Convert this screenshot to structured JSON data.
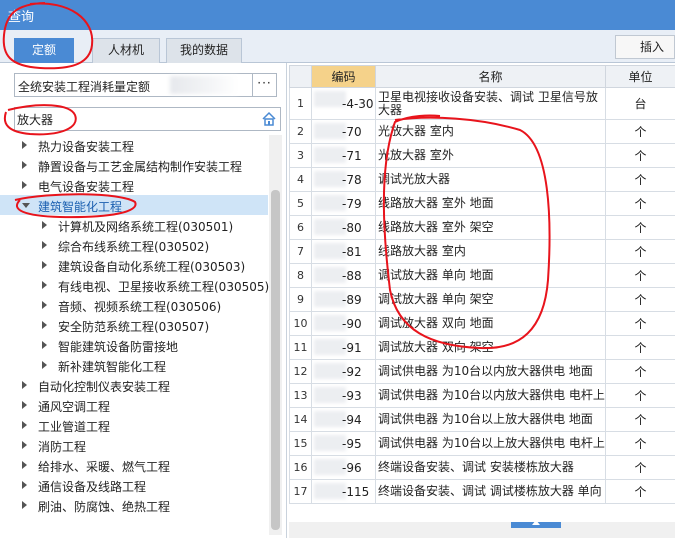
{
  "window": {
    "title": "查询"
  },
  "tabs": [
    {
      "label": "定额"
    },
    {
      "label": "人材机"
    },
    {
      "label": "我的数据"
    }
  ],
  "toolbar": {
    "insert_label": "插入(I)"
  },
  "left": {
    "quota_library": "全统安装工程消耗量定额",
    "more_label": "···",
    "search_value": "放大器",
    "tree": [
      {
        "label": "热力设备安装工程",
        "level": 0,
        "expanded": false
      },
      {
        "label": "静置设备与工艺金属结构制作安装工程",
        "level": 0,
        "expanded": false
      },
      {
        "label": "电气设备安装工程",
        "level": 0,
        "expanded": false
      },
      {
        "label": "建筑智能化工程",
        "level": 0,
        "expanded": true,
        "selected": true
      },
      {
        "label": "计算机及网络系统工程(030501)",
        "level": 1,
        "expanded": false
      },
      {
        "label": "综合布线系统工程(030502)",
        "level": 1,
        "expanded": false
      },
      {
        "label": "建筑设备自动化系统工程(030503)",
        "level": 1,
        "expanded": false
      },
      {
        "label": "有线电视、卫星接收系统工程(030505)",
        "level": 1,
        "expanded": false
      },
      {
        "label": "音频、视频系统工程(030506)",
        "level": 1,
        "expanded": false
      },
      {
        "label": "安全防范系统工程(030507)",
        "level": 1,
        "expanded": false
      },
      {
        "label": "智能建筑设备防雷接地",
        "level": 1,
        "expanded": false
      },
      {
        "label": "新补建筑智能化工程",
        "level": 1,
        "expanded": false
      },
      {
        "label": "自动化控制仪表安装工程",
        "level": 0,
        "expanded": false
      },
      {
        "label": "通风空调工程",
        "level": 0,
        "expanded": false
      },
      {
        "label": "工业管道工程",
        "level": 0,
        "expanded": false
      },
      {
        "label": "消防工程",
        "level": 0,
        "expanded": false
      },
      {
        "label": "给排水、采暖、燃气工程",
        "level": 0,
        "expanded": false
      },
      {
        "label": "通信设备及线路工程",
        "level": 0,
        "expanded": false
      },
      {
        "label": "刷油、防腐蚀、绝热工程",
        "level": 0,
        "expanded": false
      }
    ]
  },
  "grid": {
    "columns": {
      "num": "",
      "code": "编码",
      "name": "名称",
      "unit": "单位"
    },
    "rows": [
      {
        "num": "1",
        "code": "-4-30",
        "name": "卫星电视接收设备安装、调试 卫星信号放大器",
        "unit": "台"
      },
      {
        "num": "2",
        "code": "-70",
        "name": "光放大器 室内",
        "unit": "个"
      },
      {
        "num": "3",
        "code": "-71",
        "name": "光放大器 室外",
        "unit": "个"
      },
      {
        "num": "4",
        "code": "-78",
        "name": "调试光放大器",
        "unit": "个"
      },
      {
        "num": "5",
        "code": "-79",
        "name": "线路放大器 室外 地面",
        "unit": "个"
      },
      {
        "num": "6",
        "code": "-80",
        "name": "线路放大器 室外 架空",
        "unit": "个"
      },
      {
        "num": "7",
        "code": "-81",
        "name": "线路放大器 室内",
        "unit": "个"
      },
      {
        "num": "8",
        "code": "-88",
        "name": "调试放大器 单向 地面",
        "unit": "个"
      },
      {
        "num": "9",
        "code": "-89",
        "name": "调试放大器 单向 架空",
        "unit": "个"
      },
      {
        "num": "10",
        "code": "-90",
        "name": "调试放大器 双向 地面",
        "unit": "个"
      },
      {
        "num": "11",
        "code": "-91",
        "name": "调试放大器 双向 架空",
        "unit": "个"
      },
      {
        "num": "12",
        "code": "-92",
        "name": "调试供电器 为10台以内放大器供电 地面",
        "unit": "个"
      },
      {
        "num": "13",
        "code": "-93",
        "name": "调试供电器 为10台以内放大器供电 电杆上",
        "unit": "个"
      },
      {
        "num": "14",
        "code": "-94",
        "name": "调试供电器 为10台以上放大器供电 地面",
        "unit": "个"
      },
      {
        "num": "15",
        "code": "-95",
        "name": "调试供电器 为10台以上放大器供电 电杆上",
        "unit": "个"
      },
      {
        "num": "16",
        "code": "-96",
        "name": "终端设备安装、调试 安装楼栋放大器",
        "unit": "个"
      },
      {
        "num": "17",
        "code": "-115",
        "name": "终端设备安装、调试 调试楼栋放大器 单向",
        "unit": "个"
      }
    ]
  },
  "colors": {
    "accent": "#4a8ad4",
    "code_header": "#f5d28a",
    "selected_row": "#cfe4f7",
    "annotation": "#e8141c"
  }
}
